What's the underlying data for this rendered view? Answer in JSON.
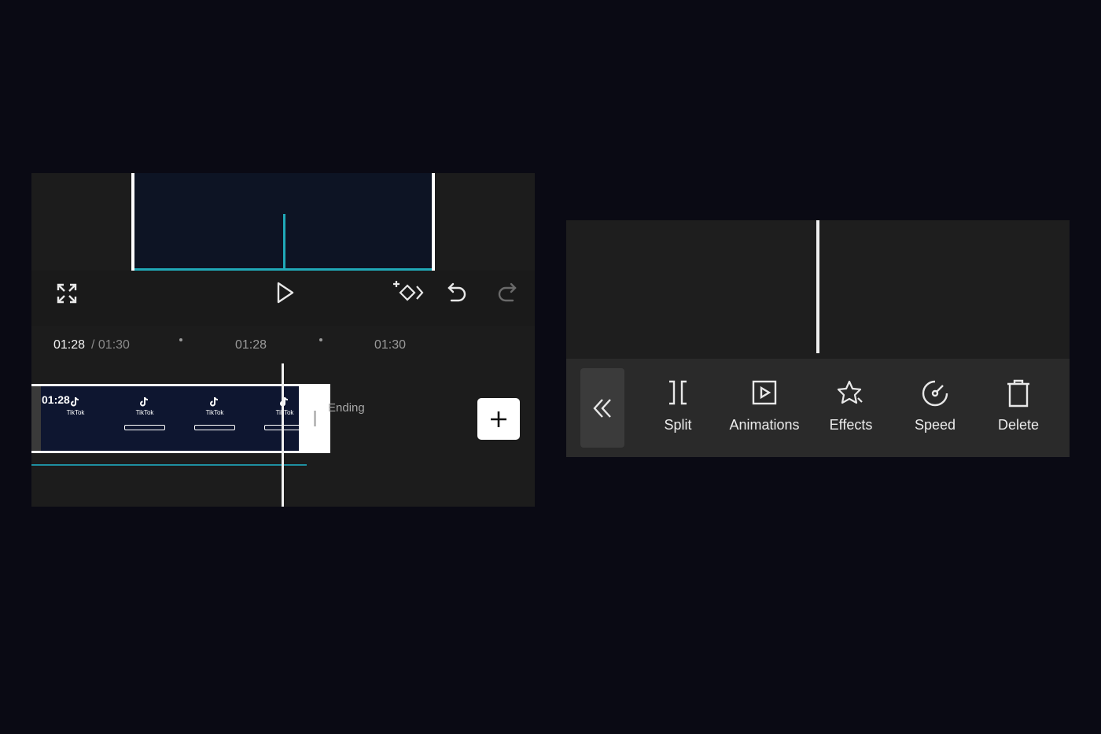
{
  "timeline": {
    "current_time": "01:28",
    "total_time": "/ 01:30",
    "ticks": [
      "01:28",
      "01:30"
    ],
    "clip_time": "01:28",
    "clip_frame_label": "TikTok",
    "ending_label": "Ending"
  },
  "toolbar": {
    "tools": [
      {
        "label": "Split",
        "icon": "split-icon"
      },
      {
        "label": "Animations",
        "icon": "animations-icon"
      },
      {
        "label": "Effects",
        "icon": "effects-icon"
      },
      {
        "label": "Speed",
        "icon": "speed-icon"
      },
      {
        "label": "Delete",
        "icon": "delete-icon"
      }
    ]
  },
  "colors": {
    "background": "#0a0a14",
    "panel": "#1c1c1c",
    "accent_cyan": "#20a9b8",
    "white": "#ffffff"
  }
}
